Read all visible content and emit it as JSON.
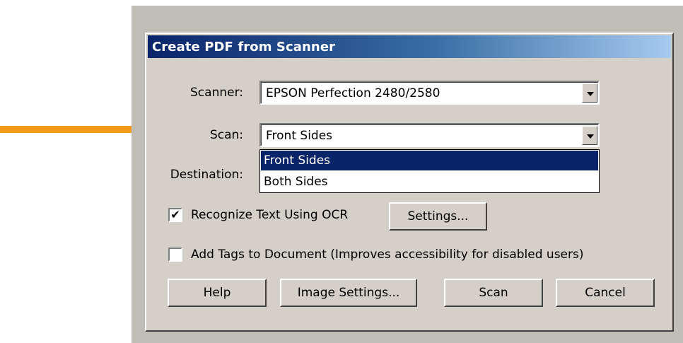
{
  "dialog": {
    "title": "Create PDF from Scanner",
    "scanner_label": "Scanner:",
    "scanner_value": "EPSON Perfection 2480/2580",
    "scan_label": "Scan:",
    "scan_value": "Front Sides",
    "scan_options": [
      "Front Sides",
      "Both Sides"
    ],
    "scan_selected_option": "Front Sides",
    "destination_label": "Destination:",
    "ocr": {
      "checked": true,
      "label": "Recognize Text Using OCR",
      "settings_label": "Settings..."
    },
    "tags": {
      "checked": false,
      "label": "Add Tags to Document (Improves accessibility for disabled users)"
    },
    "buttons": {
      "help": "Help",
      "image_settings": "Image Settings...",
      "scan": "Scan",
      "cancel": "Cancel"
    }
  },
  "annotation": {
    "arrow_color": "#f29a19",
    "arrow_icon": "right-arrow-icon"
  },
  "colors": {
    "dialog_bg": "#d4d0c8",
    "title_bar_start": "#0a246a",
    "title_bar_end": "#a6caf0",
    "selection": "#0a246a"
  }
}
